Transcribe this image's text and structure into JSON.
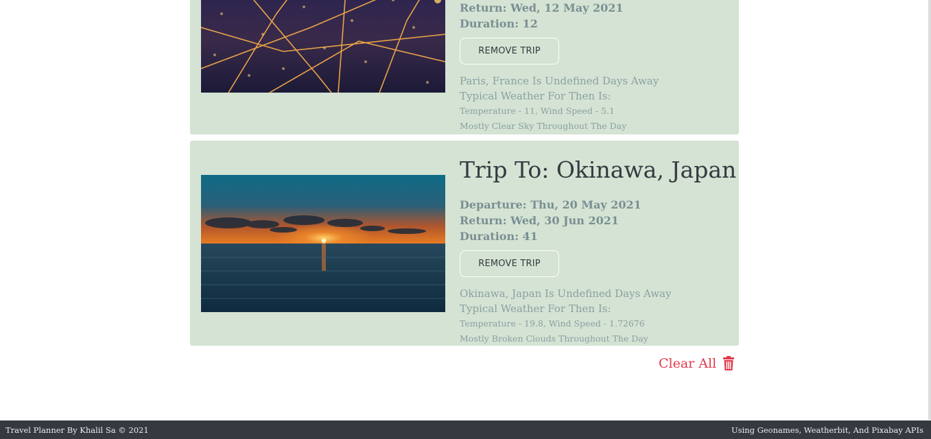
{
  "trips": [
    {
      "title": "",
      "return": "Return: Wed, 12 May 2021",
      "duration": "Duration: 12",
      "remove_label": "REMOVE TRIP",
      "days_away": "Paris, France Is Undefined Days Away",
      "weather_heading": "Typical Weather For Then Is:",
      "temp_wind": "Temperature - 11, Wind Speed - 5.1",
      "description": "Mostly Clear Sky Throughout The Day",
      "image": "paris-city-night-aerial"
    },
    {
      "title": "Trip To: Okinawa, Japan",
      "departure": "Departure: Thu, 20 May 2021",
      "return": "Return: Wed, 30 Jun 2021",
      "duration": "Duration: 41",
      "remove_label": "REMOVE TRIP",
      "days_away": "Okinawa, Japan Is Undefined Days Away",
      "weather_heading": "Typical Weather For Then Is:",
      "temp_wind": "Temperature - 19.8, Wind Speed - 1.72676",
      "description": "Mostly Broken Clouds Throughout The Day",
      "image": "okinawa-ocean-sunset"
    }
  ],
  "clear_all": {
    "label": "Clear All",
    "icon": "trash-icon",
    "color": "#e2394a"
  },
  "footer": {
    "left": "Travel Planner By Khalil Sa © 2021",
    "right": "Using Geonames, Weatherbit, And Pixabay APIs"
  },
  "colors": {
    "card_bg": "#d4e3d3",
    "footer_bg": "#343a40",
    "muted_text": "#8aa0a3"
  }
}
